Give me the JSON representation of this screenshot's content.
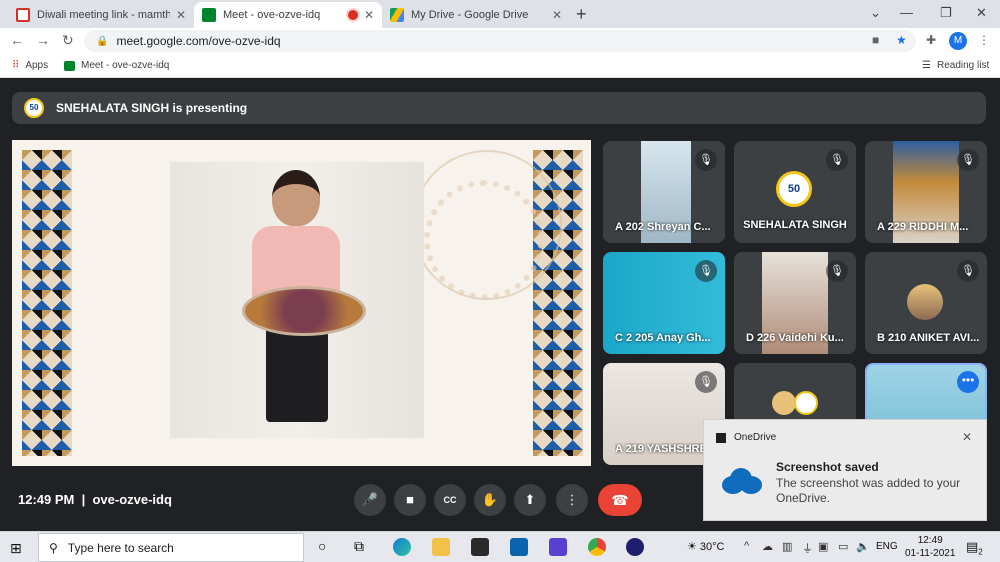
{
  "browser": {
    "tabs": [
      {
        "title": "Diwali meeting link - mamthared",
        "favicon_color": "#d93025"
      },
      {
        "title": "Meet - ove-ozve-idq",
        "favicon_color": "#00832d"
      },
      {
        "title": "My Drive - Google Drive",
        "favicon_color": "#fbbc04"
      }
    ],
    "url": "meet.google.com/ove-ozve-idq",
    "profile_initial": "M",
    "bookmarks": [
      "Apps",
      "Meet - ove-ozve-idq"
    ],
    "reading_list": "Reading list"
  },
  "meet": {
    "presenting_banner": "SNEHALATA SINGH is presenting",
    "badge_text": "50",
    "participants": [
      {
        "name": "A 202 Shreyan C..."
      },
      {
        "name": "SNEHALATA SINGH"
      },
      {
        "name": "A 229 RIDDHI M..."
      },
      {
        "name": "C 2 205 Anay Gh..."
      },
      {
        "name": "D 226 Vaidehi Ku..."
      },
      {
        "name": "B 210 ANIKET AVI..."
      },
      {
        "name": "A 219 YASHSHRE..."
      }
    ],
    "clock": "12:49 PM",
    "meeting_code": "ove-ozve-idq"
  },
  "toast": {
    "app": "OneDrive",
    "title": "Screenshot saved",
    "body": "The screenshot was added to your OneDrive."
  },
  "taskbar": {
    "search_placeholder": "Type here to search",
    "temperature": "30°C",
    "language": "ENG",
    "time": "12:49",
    "date": "01-11-2021",
    "notifications": "2"
  }
}
